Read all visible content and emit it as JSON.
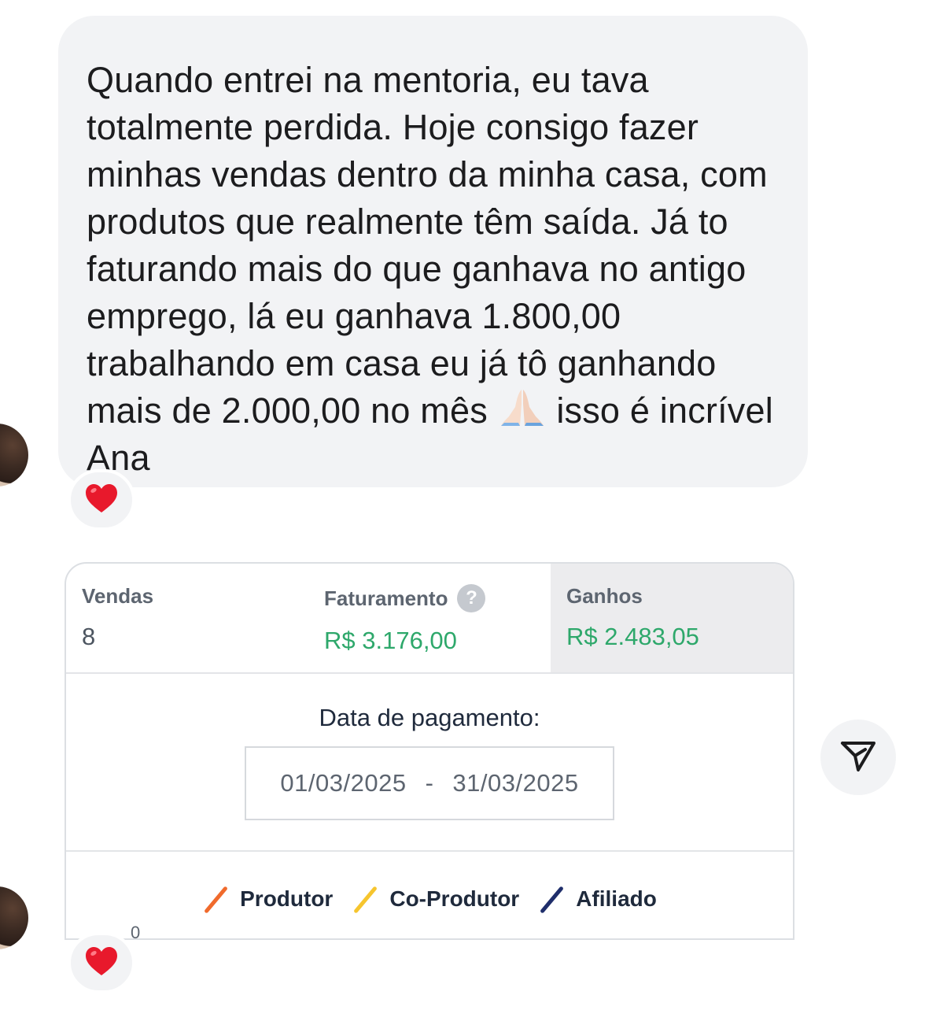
{
  "message": {
    "text_before_emoji": "Quando entrei na mentoria, eu tava totalmente perdida. Hoje consigo fazer minhas vendas dentro da minha casa, com produtos que realmente têm saída. Já to faturando mais do que ganhava no antigo emprego, lá eu ganhava 1.800,00 trabalhando em casa eu já tô ganhando mais de 2.000,00 no mês",
    "emoji": "folded-hands",
    "text_after_emoji": "isso é incrível Ana",
    "reaction": "❤️"
  },
  "image_message": {
    "stats": [
      {
        "label": "Vendas",
        "value": "8",
        "value_color": "#4c5560"
      },
      {
        "label": "Faturamento",
        "value": "R$ 3.176,00",
        "value_color": "#2ea86b",
        "help_icon": "?"
      },
      {
        "label": "Ganhos",
        "value": "R$ 2.483,05",
        "value_color": "#2ea86b",
        "active": true
      }
    ],
    "payment_date": {
      "label": "Data de pagamento:",
      "start": "01/03/2025",
      "separator": "-",
      "end": "31/03/2025"
    },
    "legend": [
      {
        "label": "Produtor",
        "color": "#f06a2c"
      },
      {
        "label": "Co-Produtor",
        "color": "#f6c52e"
      },
      {
        "label": "Afiliado",
        "color": "#1f2e6b"
      }
    ],
    "axis_partial_label": "0",
    "reaction": "❤️"
  },
  "colors": {
    "bubble_bg": "#f2f3f5",
    "text": "#1c1c1e"
  }
}
